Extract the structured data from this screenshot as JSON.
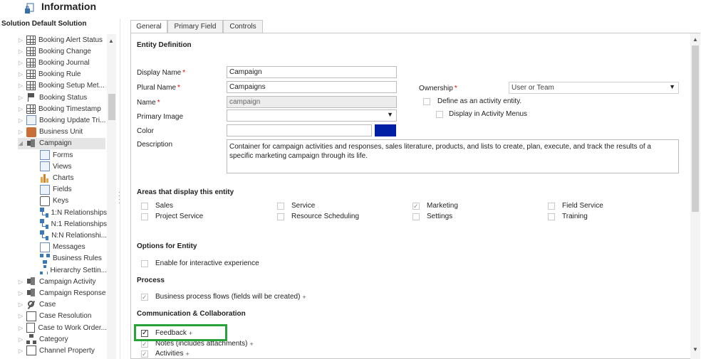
{
  "header": {
    "title": "Information",
    "icon": "lock-doc-icon"
  },
  "nav": {
    "title": "Solution Default Solution",
    "items": [
      {
        "label": "Booking Alert Status",
        "icon": "grid-icon",
        "indent": 0
      },
      {
        "label": "Booking Change",
        "icon": "grid-icon",
        "indent": 0
      },
      {
        "label": "Booking Journal",
        "icon": "grid-icon",
        "indent": 0
      },
      {
        "label": "Booking Rule",
        "icon": "grid-icon",
        "indent": 0
      },
      {
        "label": "Booking Setup Met...",
        "icon": "gear-icon",
        "indent": 0
      },
      {
        "label": "Booking Status",
        "icon": "flag-icon",
        "indent": 0
      },
      {
        "label": "Booking Timestamp",
        "icon": "grid-icon",
        "indent": 0
      },
      {
        "label": "Booking Update Tri...",
        "icon": "doc-icon",
        "indent": 0
      },
      {
        "label": "Business Unit",
        "icon": "box-icon",
        "indent": 0
      },
      {
        "label": "Campaign",
        "icon": "campaign-icon",
        "indent": 0,
        "selected": true,
        "expanded": true
      },
      {
        "label": "Forms",
        "icon": "form-icon",
        "indent": 1
      },
      {
        "label": "Views",
        "icon": "view-icon",
        "indent": 1
      },
      {
        "label": "Charts",
        "icon": "chart-icon",
        "indent": 1
      },
      {
        "label": "Fields",
        "icon": "field-icon",
        "indent": 1
      },
      {
        "label": "Keys",
        "icon": "key-icon",
        "indent": 1
      },
      {
        "label": "1:N Relationships",
        "icon": "relationship-icon",
        "indent": 1
      },
      {
        "label": "N:1 Relationships",
        "icon": "relationship-icon",
        "indent": 1
      },
      {
        "label": "N:N Relationshi...",
        "icon": "relationship-icon",
        "indent": 1
      },
      {
        "label": "Messages",
        "icon": "message-icon",
        "indent": 1
      },
      {
        "label": "Business Rules",
        "icon": "business-rule-icon",
        "indent": 1
      },
      {
        "label": "Hierarchy Settin...",
        "icon": "hierarchy-icon",
        "indent": 1
      },
      {
        "label": "Campaign Activity",
        "icon": "megaphone-icon",
        "indent": 0
      },
      {
        "label": "Campaign Response",
        "icon": "megaphone-icon",
        "indent": 0
      },
      {
        "label": "Case",
        "icon": "wrench-icon",
        "indent": 0
      },
      {
        "label": "Case Resolution",
        "icon": "case-icon",
        "indent": 0
      },
      {
        "label": "Case to Work Order...",
        "icon": "case-icon",
        "indent": 0
      },
      {
        "label": "Category",
        "icon": "category-icon",
        "indent": 0
      },
      {
        "label": "Channel Property",
        "icon": "case-icon",
        "indent": 0
      }
    ]
  },
  "tabs": [
    {
      "label": "General",
      "active": true
    },
    {
      "label": "Primary Field",
      "active": false
    },
    {
      "label": "Controls",
      "active": false
    }
  ],
  "entity_definition": {
    "heading": "Entity Definition",
    "display_name_label": "Display Name",
    "display_name_value": "Campaign",
    "plural_name_label": "Plural Name",
    "plural_name_value": "Campaigns",
    "name_label": "Name",
    "name_value": "campaign",
    "primary_image_label": "Primary Image",
    "primary_image_value": "",
    "color_label": "Color",
    "color_value": "",
    "color_swatch": "#001fa5",
    "description_label": "Description",
    "description_value": "Container for campaign activities and responses, sales literature, products, and lists to create, plan, execute, and track the results of a specific marketing campaign through its life.",
    "ownership_label": "Ownership",
    "ownership_value": "User or Team",
    "activity_entity_label": "Define as an activity entity.",
    "activity_menus_label": "Display in Activity Menus",
    "required_mark": "*"
  },
  "areas": {
    "heading": "Areas that display this entity",
    "items": [
      {
        "label": "Sales",
        "checked": false
      },
      {
        "label": "Service",
        "checked": false
      },
      {
        "label": "Marketing",
        "checked": true
      },
      {
        "label": "Field Service",
        "checked": false
      },
      {
        "label": "Project Service",
        "checked": false
      },
      {
        "label": "Resource Scheduling",
        "checked": false
      },
      {
        "label": "Settings",
        "checked": false
      },
      {
        "label": "Training",
        "checked": false
      }
    ]
  },
  "options": {
    "heading": "Options for Entity",
    "interactive_label": "Enable for interactive experience"
  },
  "process": {
    "heading": "Process",
    "bpf_label": "Business process flows (fields will be created)",
    "plus": "+"
  },
  "communication": {
    "heading": "Communication & Collaboration",
    "feedback_label": "Feedback",
    "notes_label": "Notes (includes attachments)",
    "activities_label": "Activities",
    "plus": "+"
  }
}
